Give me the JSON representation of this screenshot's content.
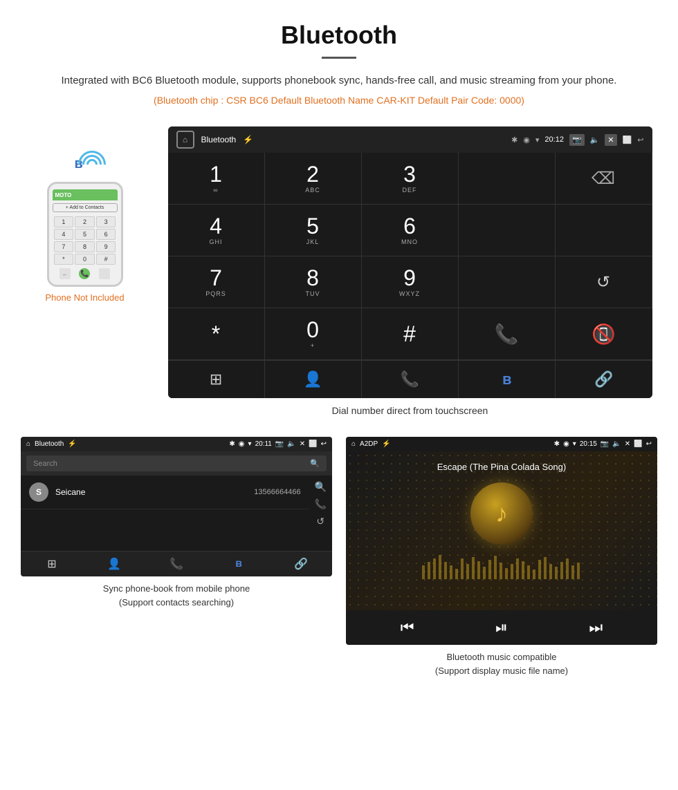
{
  "header": {
    "title": "Bluetooth",
    "description": "Integrated with BC6 Bluetooth module, supports phonebook sync, hands-free call, and music streaming from your phone.",
    "info_line": "(Bluetooth chip : CSR BC6    Default Bluetooth Name CAR-KIT    Default Pair Code: 0000)"
  },
  "phone_label": "Phone Not Included",
  "dial_screen": {
    "status_bar": {
      "label": "Bluetooth",
      "time": "20:12"
    },
    "keys": [
      {
        "num": "1",
        "sub": "∞"
      },
      {
        "num": "2",
        "sub": "ABC"
      },
      {
        "num": "3",
        "sub": "DEF"
      },
      {
        "num": "",
        "sub": ""
      },
      {
        "num": "⌫",
        "sub": ""
      },
      {
        "num": "4",
        "sub": "GHI"
      },
      {
        "num": "5",
        "sub": "JKL"
      },
      {
        "num": "6",
        "sub": "MNO"
      },
      {
        "num": "",
        "sub": ""
      },
      {
        "num": "",
        "sub": ""
      },
      {
        "num": "7",
        "sub": "PQRS"
      },
      {
        "num": "8",
        "sub": "TUV"
      },
      {
        "num": "9",
        "sub": "WXYZ"
      },
      {
        "num": "",
        "sub": ""
      },
      {
        "num": "↺",
        "sub": ""
      },
      {
        "num": "*",
        "sub": ""
      },
      {
        "num": "0",
        "sub": "+"
      },
      {
        "num": "#",
        "sub": ""
      },
      {
        "num": "📞",
        "sub": ""
      },
      {
        "num": "📵",
        "sub": ""
      }
    ],
    "bottom_icons": [
      "⊞",
      "👤",
      "📞",
      "✱",
      "🔗"
    ]
  },
  "dial_caption": "Dial number direct from touchscreen",
  "phonebook": {
    "status": {
      "label": "Bluetooth",
      "time": "20:11"
    },
    "search_placeholder": "Search",
    "contact": {
      "letter": "S",
      "name": "Seicane",
      "number": "13566664466"
    },
    "caption": "Sync phone-book from mobile phone\n(Support contacts searching)"
  },
  "music": {
    "status": {
      "label": "A2DP",
      "time": "20:15"
    },
    "song_title": "Escape (The Pina Colada Song)",
    "caption": "Bluetooth music compatible\n(Support display music file name)"
  }
}
